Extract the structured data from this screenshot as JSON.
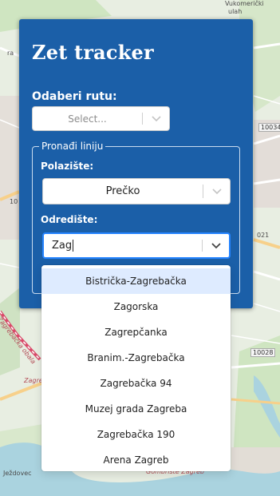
{
  "app": {
    "title": "Zet tracker"
  },
  "route": {
    "label": "Odaberi rutu:",
    "placeholder": "Select..."
  },
  "line_finder": {
    "legend": "Pronađi liniju",
    "start_label": "Polazište:",
    "start_value": "Prečko",
    "destination_label": "Odredište:",
    "destination_input": "Zag"
  },
  "dropdown": {
    "options": [
      "Bistrička-Zagrebačka",
      "Zagorska",
      "Zagrepčanka",
      "Branim.-Zagrebačka",
      "Zagrebačka 94",
      "Muzej grada Zagreba",
      "Zagrebačka 190",
      "Arena Zagreb"
    ],
    "focused_index": 0
  },
  "map": {
    "labels": {
      "top_right": "Vukomerički",
      "top_right2": "ulah",
      "road_10034": "10034",
      "road_10028": "10028",
      "road_021": "021",
      "place_jezdovec": "Ježdovec",
      "road_zagrebacka": "Zagrebačka",
      "river_obala": "Zagrebačka obala",
      "grobiste": "Gombriste Zagreb",
      "left_ra": "ra",
      "left_10": "10"
    }
  },
  "colors": {
    "panel": "#1b5fa8",
    "focus_border": "#2684ff",
    "option_focus": "#deebff",
    "river": "#aad3df",
    "railway": "#d94a6a"
  }
}
